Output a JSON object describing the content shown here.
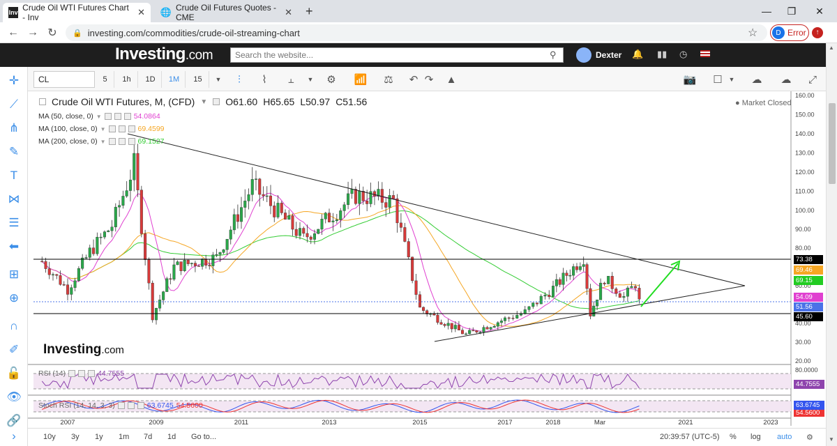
{
  "browser": {
    "tabs": [
      {
        "title": "Crude Oil WTI Futures Chart - Inv",
        "favicon": "Inv",
        "active": true
      },
      {
        "title": "Crude Oil Futures Quotes - CME",
        "favicon": "globe-icon",
        "active": false
      }
    ],
    "url": "investing.com/commodities/crude-oil-streaming-chart",
    "profile_initial": "D",
    "profile_status": "Error"
  },
  "site": {
    "logo_main": "Investing",
    "logo_suffix": ".com",
    "search_placeholder": "Search the website...",
    "user_name": "Dexter"
  },
  "toolbar": {
    "symbol": "CL",
    "intervals": [
      "5",
      "1h",
      "1D",
      "1M",
      "15"
    ],
    "active_interval": "1M"
  },
  "chart": {
    "title": "Crude Oil WTI Futures, M, (CFD)",
    "ohlc": {
      "open": "O61.60",
      "high": "H65.65",
      "low": "L50.97",
      "close": "C51.56"
    },
    "status": "Market Closed",
    "ma": [
      {
        "label": "MA (50, close, 0)",
        "value": "54.0864",
        "color": "#e040d0"
      },
      {
        "label": "MA (100, close, 0)",
        "value": "69.4599",
        "color": "#f5a623"
      },
      {
        "label": "MA (200, close, 0)",
        "value": "69.1527",
        "color": "#33cc33"
      }
    ],
    "rsi": {
      "label": "RSI (14)",
      "value": "44.7555"
    },
    "stoch": {
      "label": "Stoch RSI (14, 14, 3, 3)",
      "k": "63.6745",
      "d": "54.5600"
    },
    "watermark_main": "Investing",
    "watermark_suffix": ".com",
    "price_labels": [
      {
        "text": "73.38",
        "color": "#000000"
      },
      {
        "text": "69.46",
        "color": "#f5a623"
      },
      {
        "text": "69.15",
        "color": "#33cc33"
      },
      {
        "text": "54.09",
        "color": "#e040d0"
      },
      {
        "text": "51.56",
        "color": "#4a72e8"
      },
      {
        "text": "45.60",
        "color": "#000000"
      }
    ],
    "rsi_box": "44.7555",
    "stoch_boxes": [
      "63.6745",
      "54.5600"
    ],
    "price_axis_ticks": [
      "160.00",
      "150.00",
      "140.00",
      "130.00",
      "120.00",
      "110.00",
      "100.00",
      "90.00",
      "80.00",
      "60.00",
      "40.00",
      "30.00",
      "20.00"
    ],
    "rsi_axis_tick": "80.0000",
    "time_axis_ticks": [
      "2007",
      "2009",
      "2011",
      "2013",
      "2015",
      "2017",
      "2018",
      "Mar",
      "2021",
      "2023"
    ]
  },
  "chart_data": {
    "type": "candlestick",
    "title": "Crude Oil WTI Futures, M, (CFD)",
    "ylim": [
      20,
      160
    ],
    "x_range": [
      "2006",
      "2023"
    ],
    "approx_monthly_closes": [
      {
        "x": "2006-06",
        "y": 73
      },
      {
        "x": "2007-01",
        "y": 58
      },
      {
        "x": "2007-07",
        "y": 78
      },
      {
        "x": "2008-01",
        "y": 92
      },
      {
        "x": "2008-07",
        "y": 124
      },
      {
        "x": "2008-12",
        "y": 44
      },
      {
        "x": "2009-06",
        "y": 70
      },
      {
        "x": "2010-06",
        "y": 75
      },
      {
        "x": "2011-04",
        "y": 113
      },
      {
        "x": "2012-06",
        "y": 85
      },
      {
        "x": "2013-08",
        "y": 108
      },
      {
        "x": "2014-06",
        "y": 105
      },
      {
        "x": "2015-01",
        "y": 48
      },
      {
        "x": "2016-02",
        "y": 34
      },
      {
        "x": "2017-06",
        "y": 46
      },
      {
        "x": "2018-10",
        "y": 75
      },
      {
        "x": "2018-12",
        "y": 45
      },
      {
        "x": "2019-04",
        "y": 64
      },
      {
        "x": "2019-09",
        "y": 54
      },
      {
        "x": "2019-12",
        "y": 61
      },
      {
        "x": "2020-01",
        "y": 51.56
      }
    ],
    "horizontal_levels": [
      73.38,
      45.6,
      51.56
    ]
  },
  "bottom": {
    "ranges": [
      "10y",
      "3y",
      "1y",
      "1m",
      "7d",
      "1d"
    ],
    "goto": "Go to...",
    "time": "20:39:57 (UTC-5)",
    "pct": "%",
    "log": "log",
    "auto": "auto"
  }
}
